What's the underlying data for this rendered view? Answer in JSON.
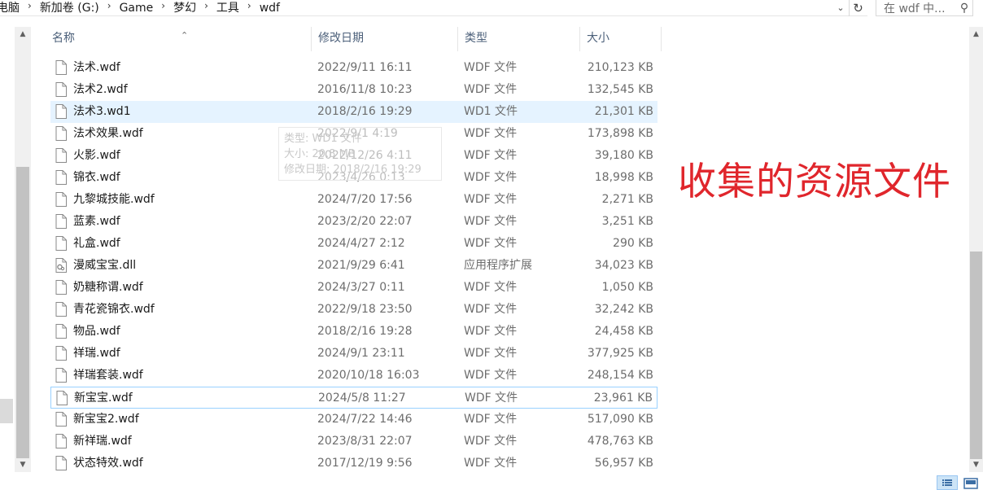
{
  "breadcrumb": [
    {
      "label": "电脑"
    },
    {
      "label": "新加卷 (G:)"
    },
    {
      "label": "Game"
    },
    {
      "label": "梦幻"
    },
    {
      "label": "工具"
    },
    {
      "label": "wdf"
    }
  ],
  "search": {
    "placeholder": "在 wdf 中..."
  },
  "columns": {
    "name": "名称",
    "date": "修改日期",
    "type": "类型",
    "size": "大小"
  },
  "rows": [
    {
      "name": "法术.wdf",
      "date": "2022/9/11 16:11",
      "type": "WDF 文件",
      "size": "210,123 KB",
      "icon": "file-icon"
    },
    {
      "name": "法术2.wdf",
      "date": "2016/11/8 10:23",
      "type": "WDF 文件",
      "size": "132,545 KB",
      "icon": "file-icon"
    },
    {
      "name": "法术3.wd1",
      "date": "2018/2/16 19:29",
      "type": "WD1 文件",
      "size": "21,301 KB",
      "icon": "file-icon",
      "highlighted": true
    },
    {
      "name": "法术效果.wdf",
      "date": "2022/9/1 4:19",
      "type": "WDF 文件",
      "size": "173,898 KB",
      "icon": "file-icon"
    },
    {
      "name": "火影.wdf",
      "date": "2022/12/26 4:11",
      "type": "WDF 文件",
      "size": "39,180 KB",
      "icon": "file-icon"
    },
    {
      "name": "锦衣.wdf",
      "date": "2023/4/26 0:13",
      "type": "WDF 文件",
      "size": "18,998 KB",
      "icon": "file-icon"
    },
    {
      "name": "九黎城技能.wdf",
      "date": "2024/7/20 17:56",
      "type": "WDF 文件",
      "size": "2,271 KB",
      "icon": "file-icon"
    },
    {
      "name": "蓝素.wdf",
      "date": "2023/2/20 22:07",
      "type": "WDF 文件",
      "size": "3,251 KB",
      "icon": "file-icon"
    },
    {
      "name": "礼盒.wdf",
      "date": "2024/4/27 2:12",
      "type": "WDF 文件",
      "size": "290 KB",
      "icon": "file-icon"
    },
    {
      "name": "漫威宝宝.dll",
      "date": "2021/9/29 6:41",
      "type": "应用程序扩展",
      "size": "34,023 KB",
      "icon": "dll-icon"
    },
    {
      "name": "奶糖称谓.wdf",
      "date": "2024/3/27 0:11",
      "type": "WDF 文件",
      "size": "1,050 KB",
      "icon": "file-icon"
    },
    {
      "name": "青花瓷锦衣.wdf",
      "date": "2022/9/18 23:50",
      "type": "WDF 文件",
      "size": "32,242 KB",
      "icon": "file-icon"
    },
    {
      "name": "物品.wdf",
      "date": "2018/2/16 19:28",
      "type": "WDF 文件",
      "size": "24,458 KB",
      "icon": "file-icon"
    },
    {
      "name": "祥瑞.wdf",
      "date": "2024/9/1 23:11",
      "type": "WDF 文件",
      "size": "377,925 KB",
      "icon": "file-icon"
    },
    {
      "name": "祥瑞套装.wdf",
      "date": "2020/10/18 16:03",
      "type": "WDF 文件",
      "size": "248,154 KB",
      "icon": "file-icon"
    },
    {
      "name": "新宝宝.wdf",
      "date": "2024/5/8 11:27",
      "type": "WDF 文件",
      "size": "23,961 KB",
      "icon": "file-icon",
      "focused": true
    },
    {
      "name": "新宝宝2.wdf",
      "date": "2024/7/22 14:46",
      "type": "WDF 文件",
      "size": "517,090 KB",
      "icon": "file-icon"
    },
    {
      "name": "新祥瑞.wdf",
      "date": "2023/8/31 22:07",
      "type": "WDF 文件",
      "size": "478,763 KB",
      "icon": "file-icon"
    },
    {
      "name": "状态特效.wdf",
      "date": "2017/12/19 9:56",
      "type": "WDF 文件",
      "size": "56,957 KB",
      "icon": "file-icon"
    }
  ],
  "tooltip": {
    "type_line": "类型: WD1 文件",
    "size_line": "大小: 20.8 MB",
    "date_line": "修改日期: 2018/2/16 19:29"
  },
  "annotation": {
    "text": "收集的资源文件",
    "color": "#e0262c"
  },
  "colors": {
    "header_text": "#4c607a",
    "row_highlight": "#e5f3ff",
    "focus_border": "#99d1ff",
    "secondary_text": "#6d6d6d"
  }
}
